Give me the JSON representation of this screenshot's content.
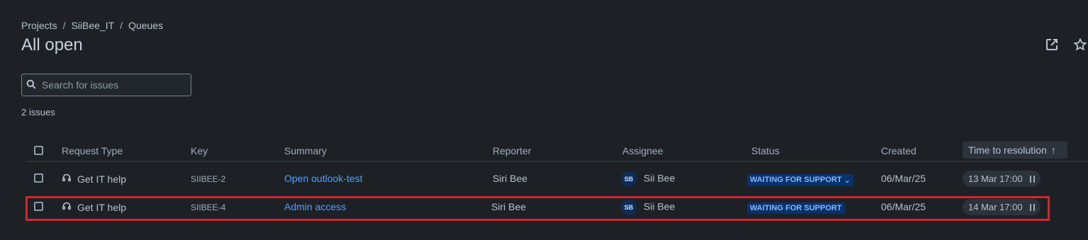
{
  "breadcrumb": {
    "items": [
      "Projects",
      "SiiBee_IT",
      "Queues"
    ],
    "separator": "/"
  },
  "page": {
    "title": "All open"
  },
  "header_icons": [
    "share-icon",
    "star-icon"
  ],
  "search": {
    "placeholder": "Search for issues",
    "value": ""
  },
  "issue_count": "2 issues",
  "table": {
    "columns": [
      "Request Type",
      "Key",
      "Summary",
      "Reporter",
      "Assignee",
      "Status",
      "Created",
      "Time to resolution"
    ],
    "sort_indicator": "↑",
    "rows": [
      {
        "request_type": "Get IT help",
        "key": "SIIBEE-2",
        "summary": "Open outlook-test",
        "reporter": "Siri Bee",
        "assignee_initials": "SB",
        "assignee": "Sii Bee",
        "status": "WAITING FOR SUPPORT",
        "status_chevron": "⌄",
        "created": "06/Mar/25",
        "time_to_resolution": "13 Mar 17:00"
      },
      {
        "request_type": "Get IT help",
        "key": "SIIBEE-4",
        "summary": "Admin access",
        "reporter": "Siri Bee",
        "assignee_initials": "SB",
        "assignee": "Sii Bee",
        "status": "WAITING FOR SUPPORT",
        "status_chevron": "",
        "created": "06/Mar/25",
        "time_to_resolution": "14 Mar 17:00"
      }
    ]
  },
  "colors": {
    "background": "#1d2125",
    "link": "#579dff",
    "status_bg": "#09326c",
    "status_text": "#85b8ff",
    "highlight": "#d4242e"
  }
}
